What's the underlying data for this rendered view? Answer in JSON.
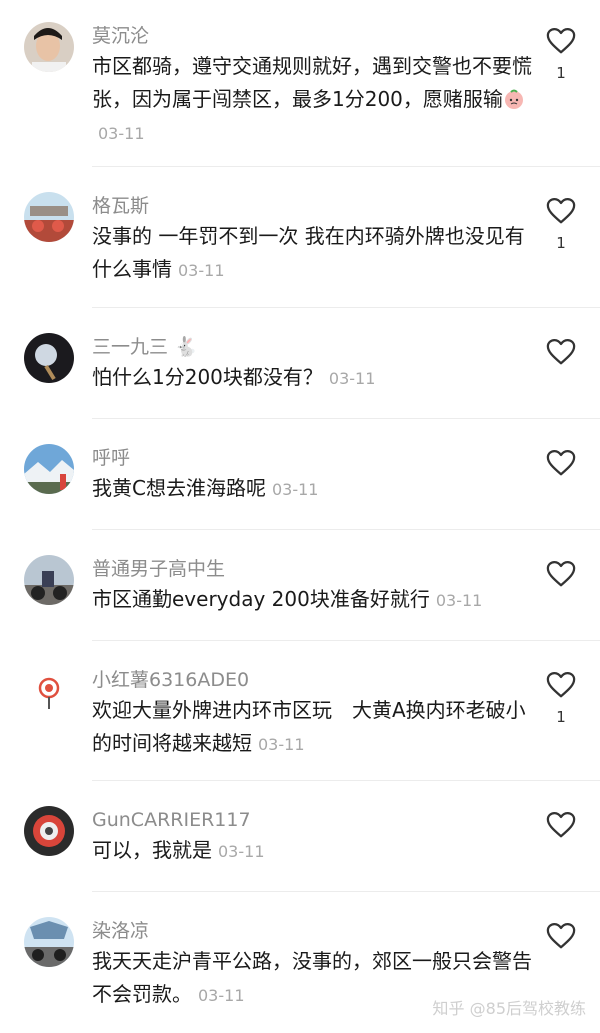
{
  "comments": [
    {
      "user": "莫沉沦",
      "text": "市区都骑，遵守交通规则就好，遇到交警也不要慌张，因为属于闯禁区，最多1分200，愿赌服输",
      "date": "03-11",
      "likes": "1"
    },
    {
      "user": "格瓦斯",
      "text": "没事的 一年罚不到一次 我在内环骑外牌也没见有什么事情",
      "date": "03-11",
      "likes": "1"
    },
    {
      "user": "三一九三 🐇",
      "text": "怕什么1分200块都没有？",
      "date": "03-11",
      "likes": ""
    },
    {
      "user": "呼呼",
      "text": "我黄C想去淮海路呢",
      "date": "03-11",
      "likes": ""
    },
    {
      "user": "普通男子高中生",
      "text": "市区通勤everyday 200块准备好就行",
      "date": "03-11",
      "likes": ""
    },
    {
      "user": "小红薯6316ADE0",
      "text": "欢迎大量外牌进内环市区玩　大黄A换内环老破小的时间将越来越短",
      "date": "03-11",
      "likes": "1"
    },
    {
      "user": "GunCARRIER117",
      "text": "可以，我就是",
      "date": "03-11",
      "likes": ""
    },
    {
      "user": "染洛凉",
      "text": "我天天走沪青平公路，没事的，郊区一般只会警告不会罚款。",
      "date": "03-11",
      "likes": ""
    }
  ],
  "watermark": "知乎 @85后驾校教练",
  "colors": {
    "username": "#8c8c8c",
    "text": "#1a1a1a",
    "date": "#a8a8a8",
    "heart": "#333333"
  },
  "icons": {
    "like": "heart-outline-icon",
    "emoji": "peach-emoji-icon"
  }
}
